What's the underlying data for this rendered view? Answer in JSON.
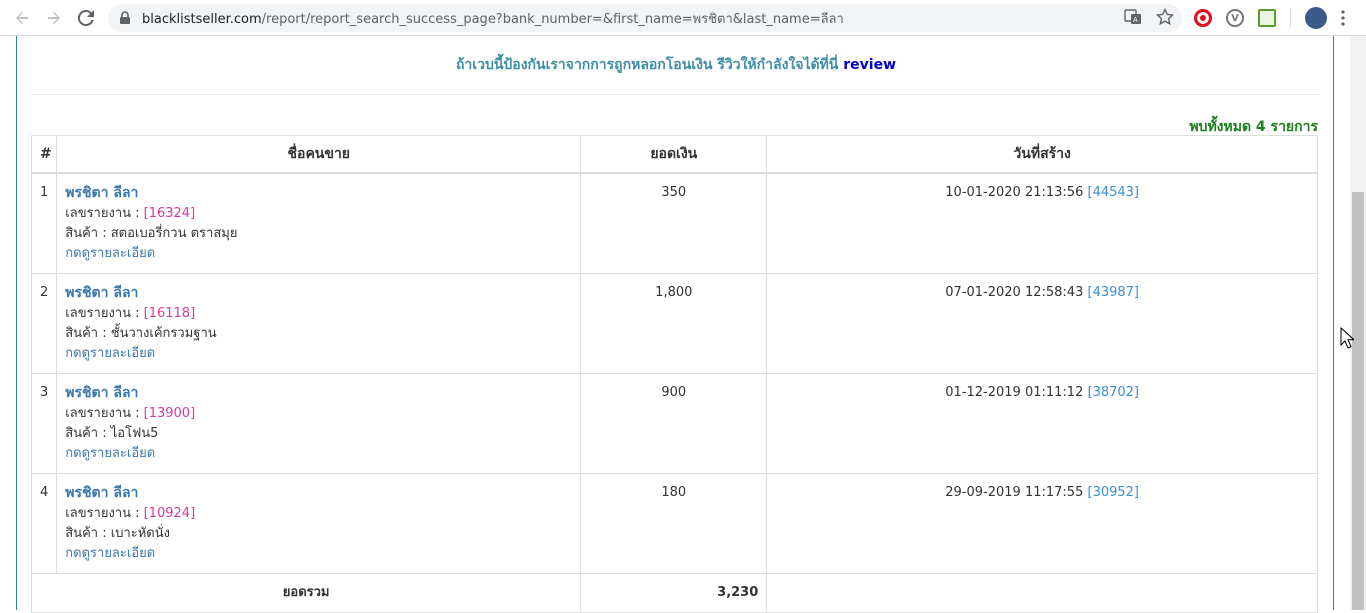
{
  "browser": {
    "url_host": "blacklistseller.com",
    "url_path": "/report/report_search_success_page?bank_number=&first_name=พรชิตา&last_name=ลีลา"
  },
  "page": {
    "banner_text": "ถ้าเวบนี้ป้องกันเราจากการถูกหลอกโอนเงิน รีวิวให้กำลังใจได้ที่นี่",
    "banner_link": "review",
    "found_text": "พบทั้งหมด 4 รายการ"
  },
  "table": {
    "headers": [
      "#",
      "ชื่อคนขาย",
      "ยอดเงิน",
      "วันที่สร้าง"
    ],
    "rows": [
      {
        "num": "1",
        "name": "พรชิตา ลีลา",
        "report_label": "เลขรายงาน : ",
        "report_id": "[16324]",
        "product_label": "สินค้า : ",
        "product": "สตอเบอรี่กวน ตราสมุย",
        "detail": "กดดูรายละเอียด",
        "amount": "350",
        "date": "10-01-2020 21:13:56",
        "ref": "[44543]"
      },
      {
        "num": "2",
        "name": "พรชิตา ลีลา",
        "report_label": "เลขรายงาน : ",
        "report_id": "[16118]",
        "product_label": "สินค้า : ",
        "product": "ชั้นวางเค้กรวมฐาน",
        "detail": "กดดูรายละเอียด",
        "amount": "1,800",
        "date": "07-01-2020 12:58:43",
        "ref": "[43987]"
      },
      {
        "num": "3",
        "name": "พรชิตา ลีลา",
        "report_label": "เลขรายงาน : ",
        "report_id": "[13900]",
        "product_label": "สินค้า : ",
        "product": "ไอโฟน5",
        "detail": "กดดูรายละเอียด",
        "amount": "900",
        "date": "01-12-2019 01:11:12",
        "ref": "[38702]"
      },
      {
        "num": "4",
        "name": "พรชิตา ลีลา",
        "report_label": "เลขรายงาน : ",
        "report_id": "[10924]",
        "product_label": "สินค้า : ",
        "product": "เบาะหัดนั่ง",
        "detail": "กดดูรายละเอียด",
        "amount": "180",
        "date": "29-09-2019 11:17:55",
        "ref": "[30952]"
      }
    ],
    "total_label": "ยอดรวม",
    "total_value": "3,230"
  }
}
